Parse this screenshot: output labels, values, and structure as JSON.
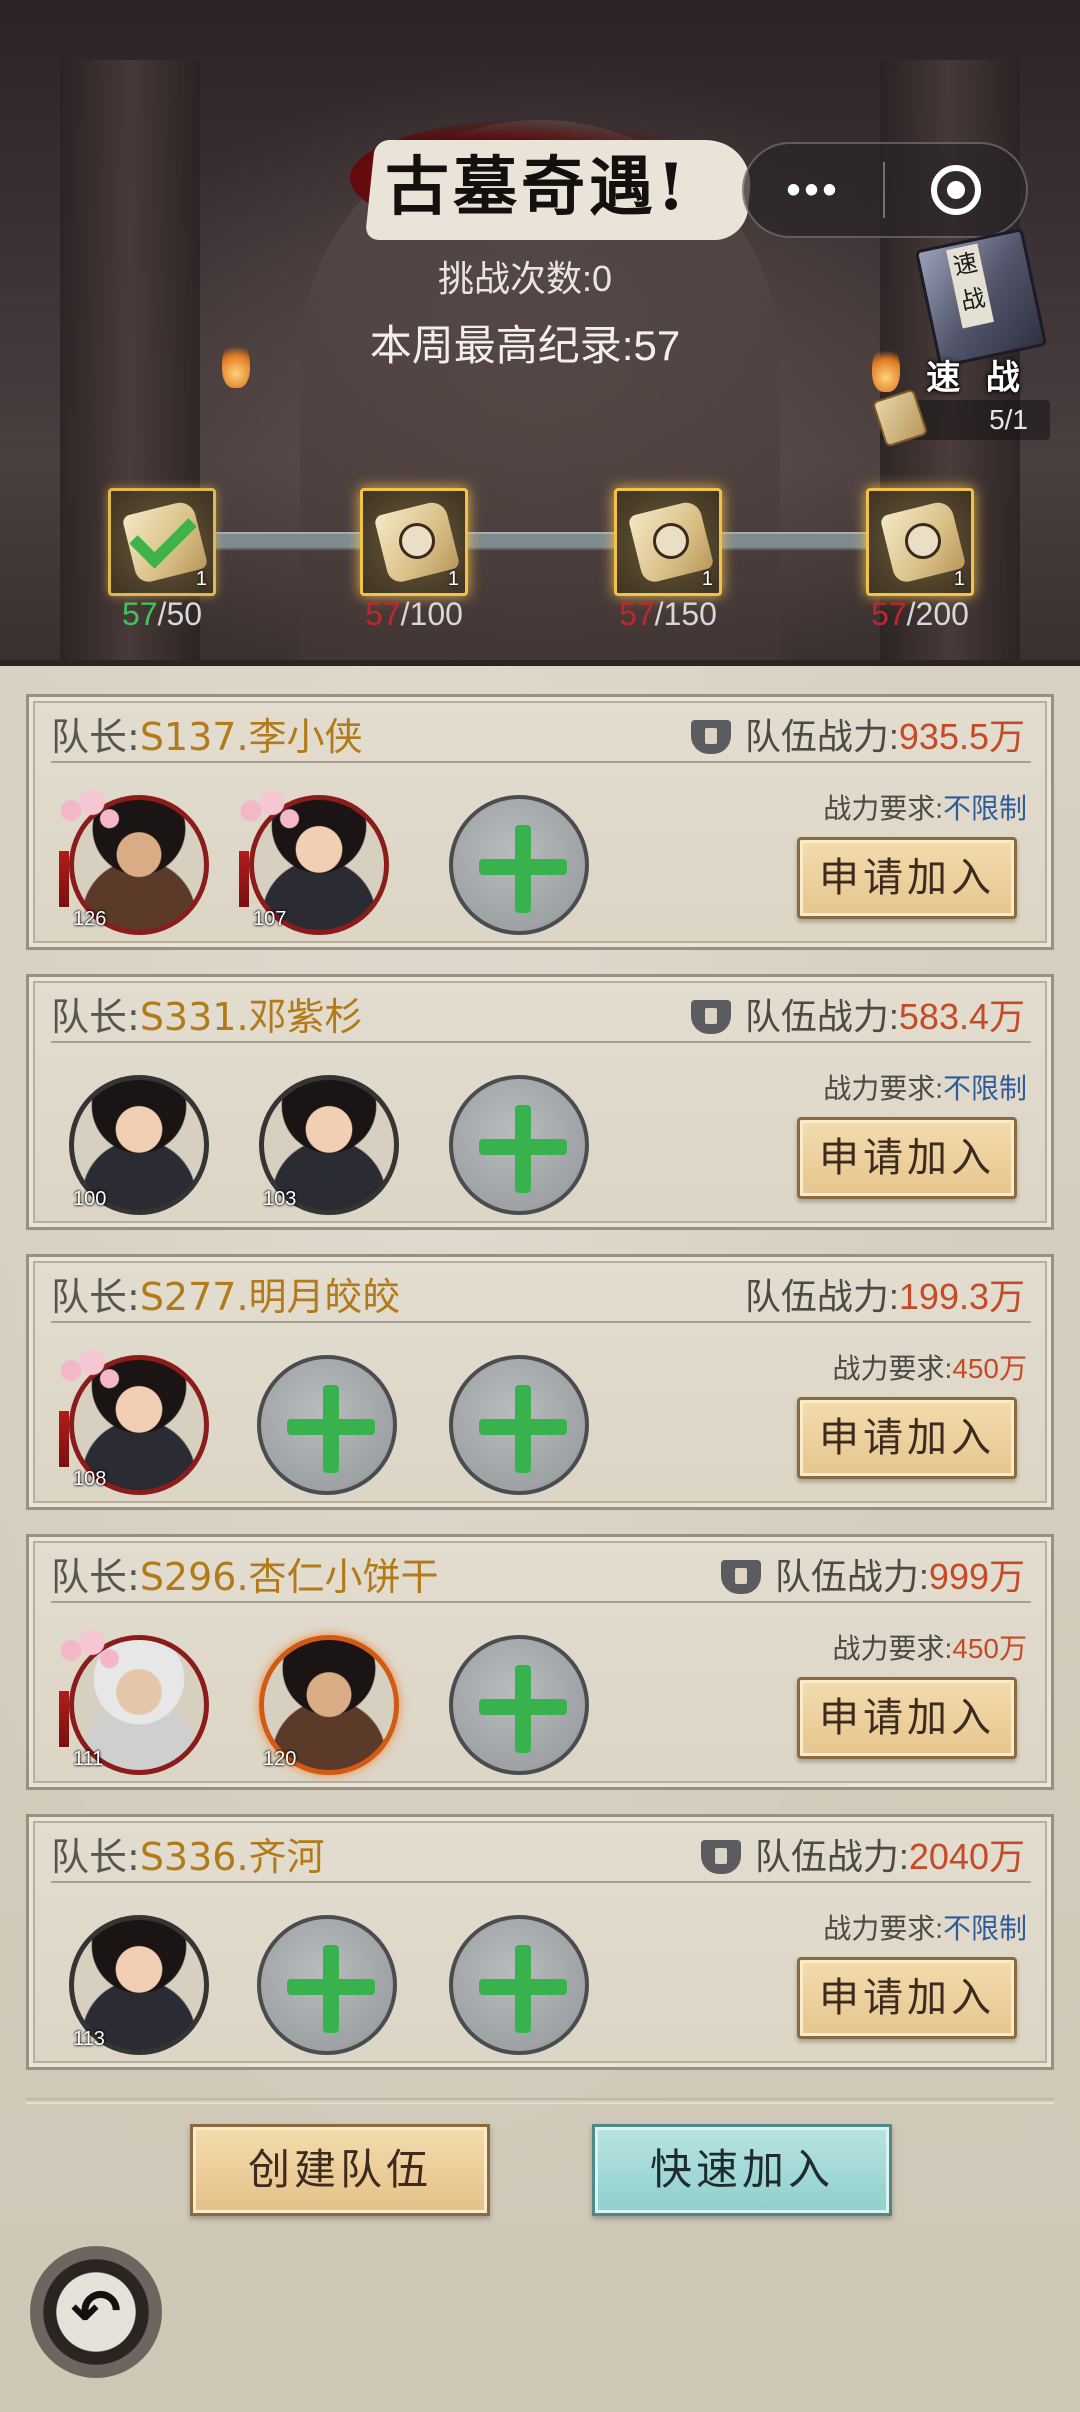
{
  "header": {
    "title": "古墓奇遇!",
    "more_icon": "•••",
    "challenge_label": "挑战次数:0",
    "record_label": "本周最高纪录:57"
  },
  "quick_battle": {
    "book_text": "速战",
    "label": "速 战",
    "quota": "5/1"
  },
  "milestones": [
    {
      "current": "57",
      "target": "/50",
      "count": "1",
      "claimed": true
    },
    {
      "current": "57",
      "target": "/100",
      "count": "1",
      "claimed": false
    },
    {
      "current": "57",
      "target": "/150",
      "count": "1",
      "claimed": false
    },
    {
      "current": "57",
      "target": "/200",
      "count": "1",
      "claimed": false
    }
  ],
  "teams": [
    {
      "leader_prefix": "队长:",
      "leader_name": "S137.李小侠",
      "power_label": "队伍战力:",
      "power_value": "935.5万",
      "req_label": "战力要求:",
      "req_value": "不限制",
      "members": [
        {
          "level": "126"
        },
        {
          "level": "107"
        }
      ],
      "apply_label": "申请加入"
    },
    {
      "leader_prefix": "队长:",
      "leader_name": "S331.邓紫杉",
      "power_label": "队伍战力:",
      "power_value": "583.4万",
      "req_label": "战力要求:",
      "req_value": "不限制",
      "members": [
        {
          "level": "100"
        },
        {
          "level": "103"
        }
      ],
      "apply_label": "申请加入"
    },
    {
      "leader_prefix": "队长:",
      "leader_name": "S277.明月皎皎",
      "power_label": "队伍战力:",
      "power_value": "199.3万",
      "req_label": "战力要求:",
      "req_value": "450万",
      "members": [
        {
          "level": "108"
        }
      ],
      "apply_label": "申请加入"
    },
    {
      "leader_prefix": "队长:",
      "leader_name": "S296.杏仁小饼干",
      "power_label": "队伍战力:",
      "power_value": "999万",
      "req_label": "战力要求:",
      "req_value": "450万",
      "members": [
        {
          "level": "111"
        },
        {
          "level": "120"
        }
      ],
      "apply_label": "申请加入"
    },
    {
      "leader_prefix": "队长:",
      "leader_name": "S336.齐河",
      "power_label": "队伍战力:",
      "power_value": "2040万",
      "req_label": "战力要求:",
      "req_value": "不限制",
      "members": [
        {
          "level": "113"
        }
      ],
      "apply_label": "申请加入"
    }
  ],
  "footer": {
    "create_label": "创建队伍",
    "quick_join_label": "快速加入",
    "back_icon": "back-arrow-icon"
  },
  "colors": {
    "gold_name": "#b27a18",
    "power_red": "#c54b26",
    "req_blue": "#2f5c9c",
    "progress_ok": "#43c15a",
    "progress_bad": "#c0272d"
  }
}
